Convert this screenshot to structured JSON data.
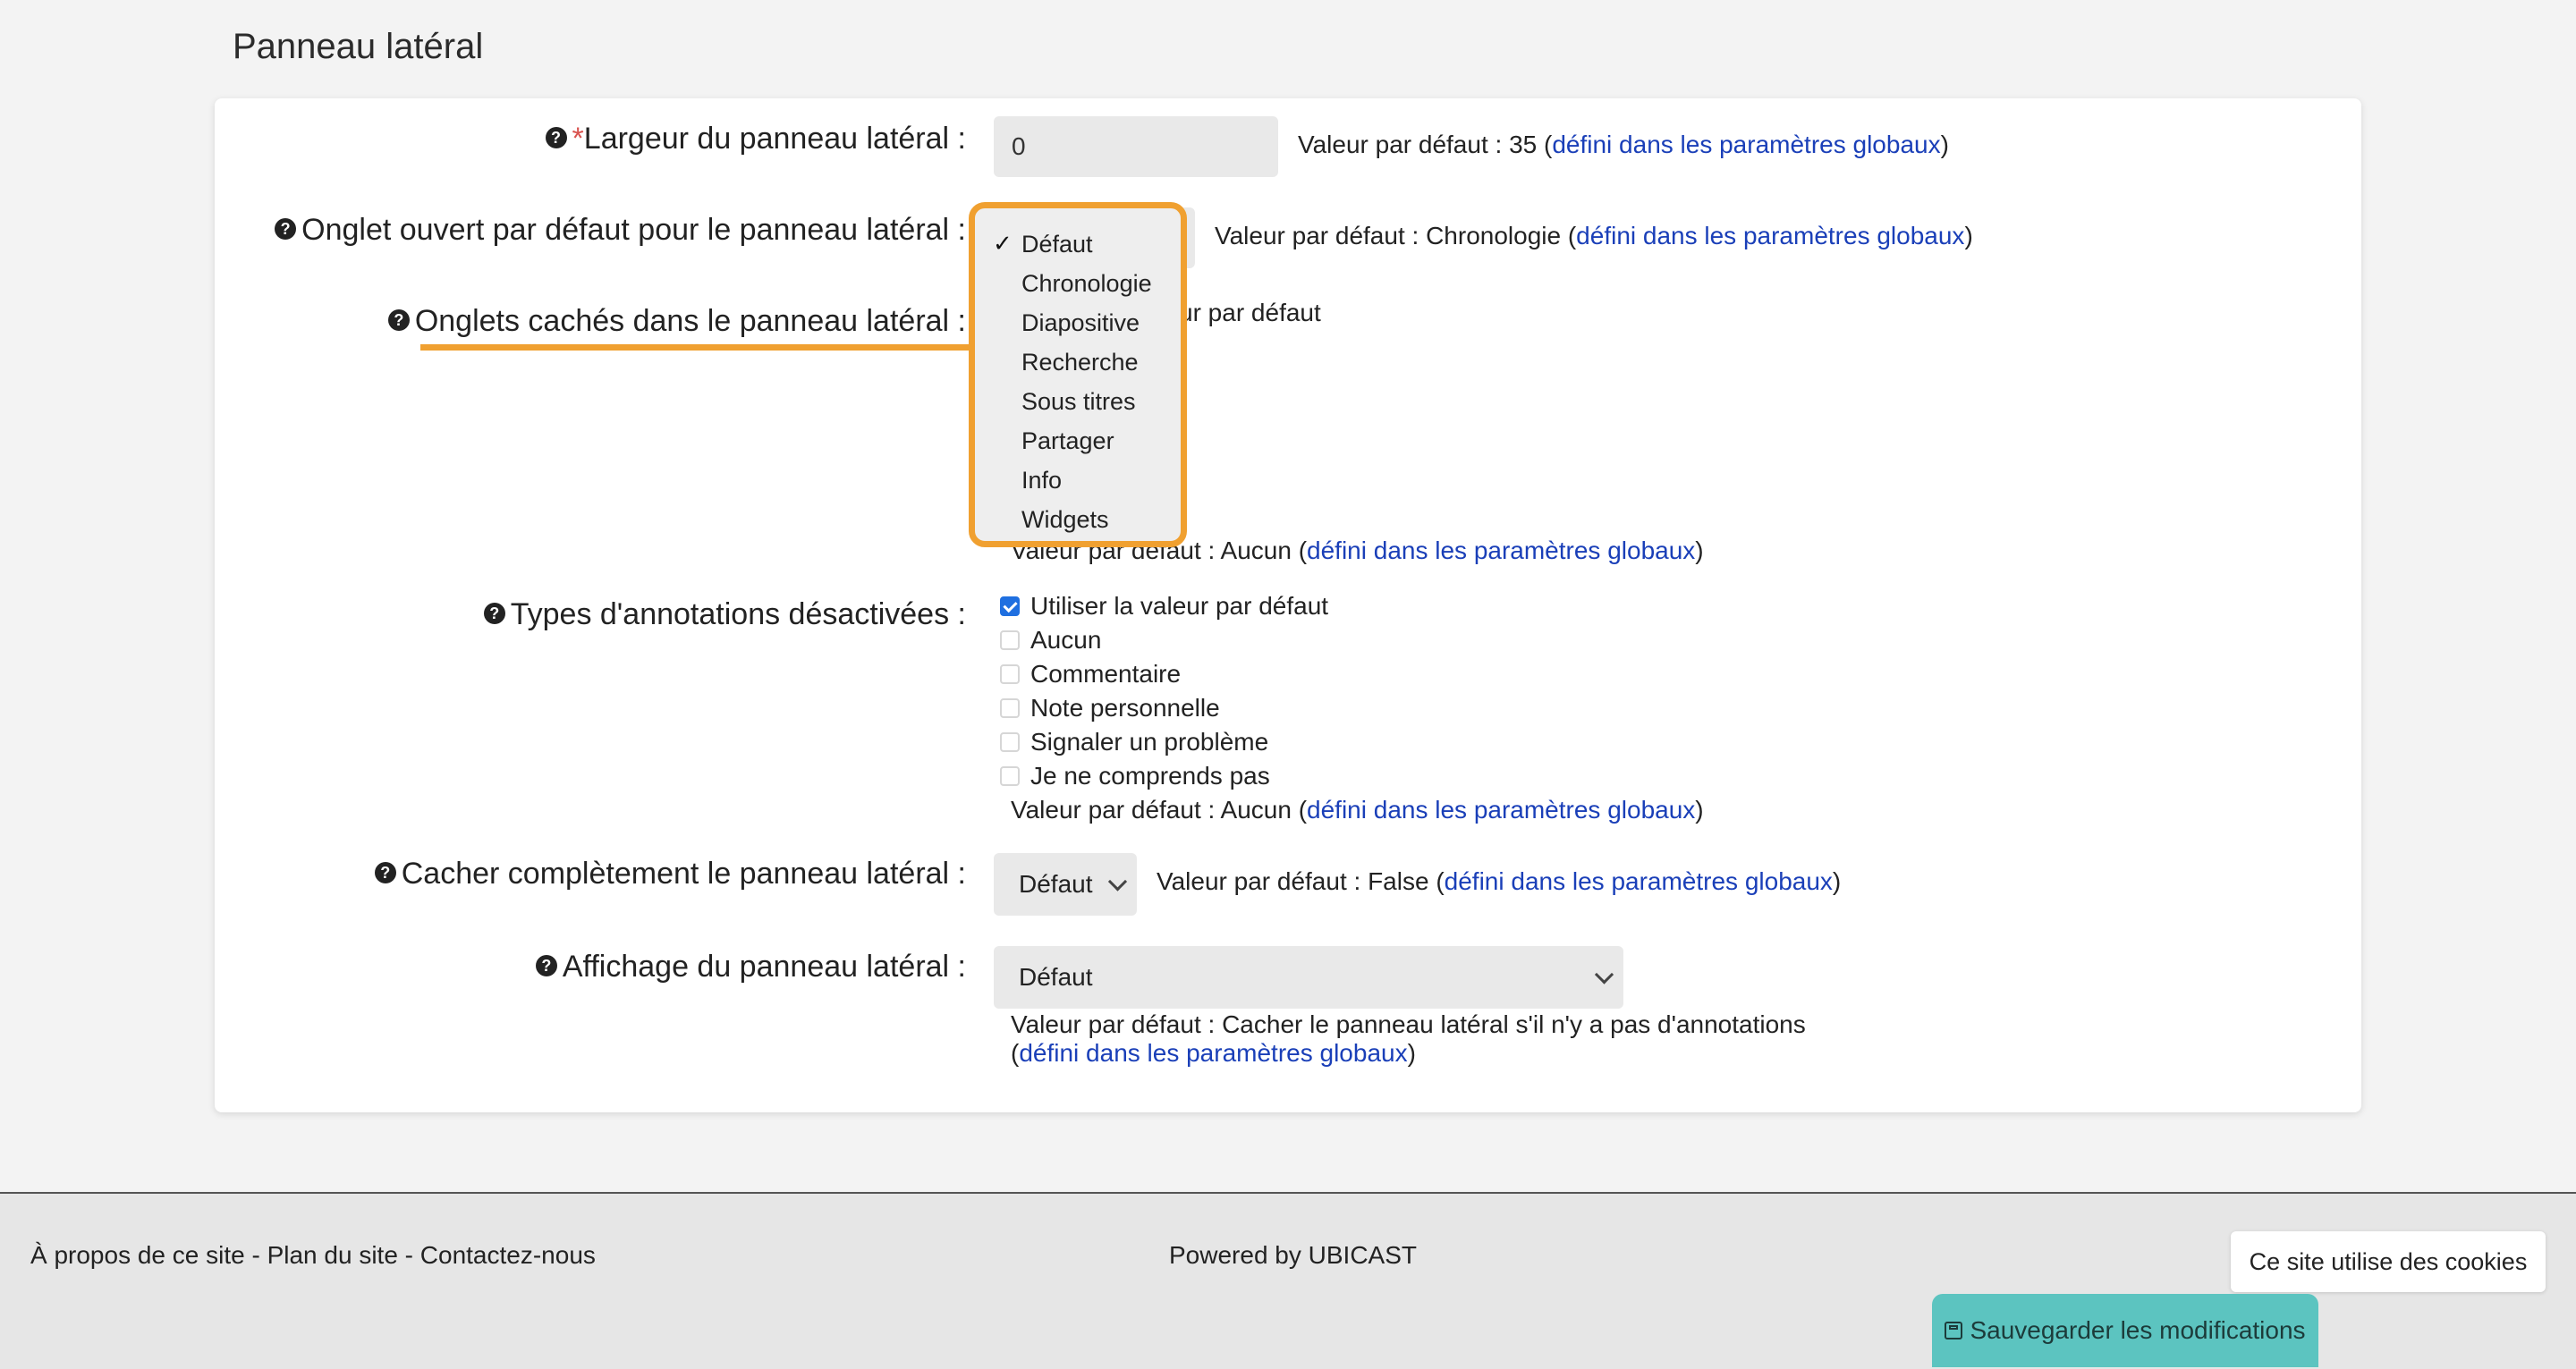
{
  "section": {
    "title": "Panneau latéral"
  },
  "common": {
    "link_text": "défini dans les paramètres globaux"
  },
  "fields": {
    "width": {
      "label": "Largeur du panneau latéral :",
      "required_mark": "*",
      "value": "0",
      "hint_prefix": "Valeur par défaut : 35 (",
      "hint_suffix": ")"
    },
    "default_tab": {
      "label": "Onglet ouvert par défaut pour le panneau latéral :",
      "hint_prefix": "Valeur par défaut : Chronologie (",
      "hint_suffix": ")",
      "dropdown": {
        "selected_check": "✓",
        "options": [
          "Défaut",
          "Chronologie",
          "Diapositive",
          "Recherche",
          "Sous titres",
          "Partager",
          "Info",
          "Widgets"
        ]
      }
    },
    "hidden_tabs": {
      "label": "Onglets cachés dans le panneau latéral :",
      "partial_hint": "ur par défaut",
      "hint_prefix": "Valeur par défaut : Aucun (",
      "hint_suffix": ")"
    },
    "annotation_types": {
      "label": "Types d'annotations désactivées :",
      "options": [
        {
          "label": "Utiliser la valeur par défaut",
          "checked": true
        },
        {
          "label": "Aucun",
          "checked": false
        },
        {
          "label": "Commentaire",
          "checked": false
        },
        {
          "label": "Note personnelle",
          "checked": false
        },
        {
          "label": "Signaler un problème",
          "checked": false
        },
        {
          "label": "Je ne comprends pas",
          "checked": false
        }
      ],
      "hint_prefix": "Valeur par défaut : Aucun (",
      "hint_suffix": ")"
    },
    "hide_panel": {
      "label": "Cacher complètement le panneau latéral :",
      "selected": "Défaut",
      "hint_prefix": "Valeur par défaut : False (",
      "hint_suffix": ")"
    },
    "panel_display": {
      "label": "Affichage du panneau latéral :",
      "selected": "Défaut",
      "hint_line1": "Valeur par défaut : Cacher le panneau latéral s'il n'y a pas d'annotations",
      "hint_line2_prefix": "(",
      "hint_line2_suffix": ")"
    }
  },
  "footer": {
    "left": "À propos de ce site - Plan du site - Contactez-nous",
    "center": "Powered by UBICAST",
    "cookie_notice": "Ce site utilise des cookies",
    "save_button": "Sauvegarder les modifications"
  },
  "colors": {
    "highlight": "#f0a030",
    "link": "#1a3fb8",
    "save_button": "#5cc4c0",
    "checkbox": "#1f6fe0"
  }
}
